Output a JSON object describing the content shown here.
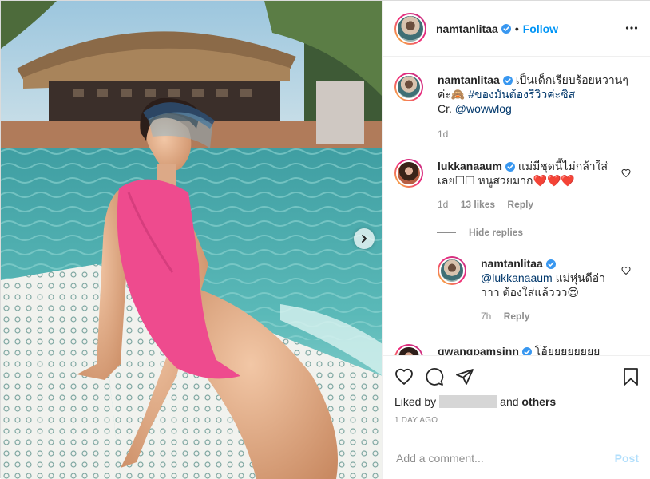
{
  "post": {
    "username": "namtanlitaa",
    "follow_label": "Follow",
    "dot": "•"
  },
  "caption": {
    "username": "namtanlitaa",
    "text_line1": "เป็นเด็กเรียบร้อยหวานๆ",
    "text_line2": "ค่ะ🙈 ",
    "hashtag": "#ของมันต้องรีวิวค่ะซิส",
    "credit_prefix": "Cr. ",
    "credit_mention": "@wowwlog",
    "time": "1d"
  },
  "comments": [
    {
      "username": "lukkanaaum",
      "text_line1": "แม่มีชุดนี้ไม่กล้าใส่",
      "text_line2": "เลย☐☐ หนูสวยมาก❤️❤️❤️",
      "time": "1d",
      "likes": "13 likes",
      "reply_label": "Reply"
    }
  ],
  "hide_replies_label": "Hide replies",
  "reply": {
    "username": "namtanlitaa",
    "mention": "@lukkanaaum",
    "text_line1": " แม่หุ่นดีอ่า",
    "text_line2": "าาา ต้องใส่แล้ววว😍",
    "time": "7h",
    "reply_label": "Reply"
  },
  "partial_comment": {
    "username": "gwangpamsinn",
    "text": "โอ้ยยยยยยยย"
  },
  "likes": {
    "prefix": "Liked by",
    "suffix": "others",
    "and": "and"
  },
  "posted_time": "1 DAY AGO",
  "add_comment": {
    "placeholder": "Add a comment...",
    "post_label": "Post"
  },
  "colors": {
    "accent": "#0095f6",
    "verified": "#3897f0",
    "post_disabled": "#b2dffc",
    "muted": "#8e8e8e"
  }
}
